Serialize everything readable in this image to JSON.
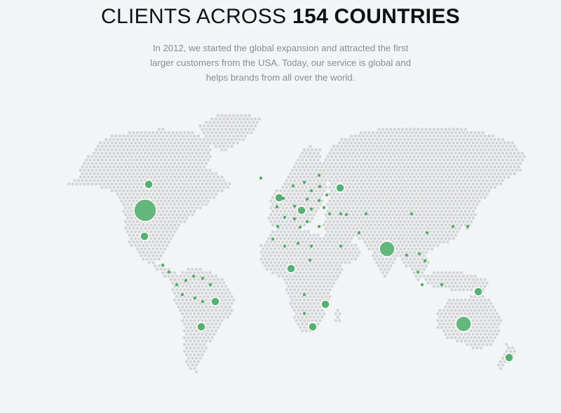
{
  "heading": {
    "prefix": "CLIENTS ACROSS",
    "emphasis": "154 COUNTRIES"
  },
  "description": {
    "line1": "In 2012, we started the global expansion and attracted the first",
    "line2": "larger customers from the USA. Today, our service is global and",
    "line3": "helps brands from all over the world."
  },
  "colors": {
    "background": "#f3f4f6",
    "land_dot": "#d4d4d4",
    "client_marker": "#4caf6a"
  },
  "map": {
    "style": "dotted-world-map",
    "marker_meaning": "client locations, circle size indicates client concentration"
  }
}
